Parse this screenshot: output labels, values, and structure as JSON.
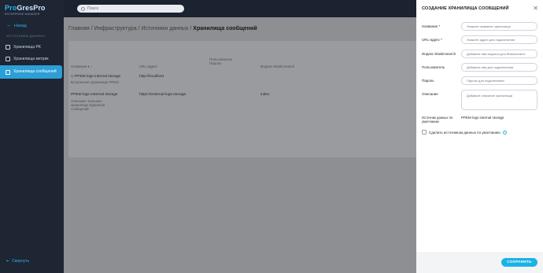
{
  "app": {
    "logo_line1_a": "Pro",
    "logo_line1_b": "GresPro",
    "logo_line2": "ENTERPRISE MANAGER"
  },
  "sidebar": {
    "back_label": "Назад",
    "section_title": "ИСТОЧНИКИ ДАННЫХ",
    "items": [
      {
        "label": "Хранилища PK"
      },
      {
        "label": "Хранилища метрик"
      },
      {
        "label": "Хранилища сообщений"
      }
    ],
    "collapse_label": "Свернуть"
  },
  "search": {
    "placeholder": "Поиск"
  },
  "breadcrumb": {
    "parts": [
      "Главная",
      "Инфраструктура",
      "Источники данных"
    ],
    "separator": " / ",
    "current": "Хранилища сообщений"
  },
  "table": {
    "headers": [
      "Название",
      "URL-адрес",
      "Пользователь Пароль",
      "Индекс Elasticsearch"
    ],
    "rows": [
      {
        "name": "PPEM logs internal storage",
        "sub": "Встроенное хранилище PPEM",
        "url": "http://localhost",
        "user": "",
        "index": ""
      },
      {
        "name": "PPEM logs external storage",
        "sub": "Описание: внешнее хранилище журналов сообщений",
        "url": "https://external-logs.storage",
        "user": "",
        "index": "index"
      }
    ]
  },
  "panel": {
    "title": "СОЗДАНИЕ ХРАНИЛИЩА СООБЩЕНИЙ",
    "fields": {
      "name_label": "Название *",
      "name_placeholder": "Укажите название хранилища",
      "url_label": "URL-адрес *",
      "url_placeholder": "Укажите адрес для подключения",
      "index_label": "Индекс Elasticsearch",
      "index_placeholder": "Добавьте имя индекса для Elasticsearch",
      "user_label": "Пользователь",
      "user_placeholder": "Добавьте имя для подключения",
      "password_label": "Пароль",
      "password_placeholder": "Пароль для подключения",
      "desc_label": "Описание",
      "desc_placeholder": "Добавьте описание хранилища"
    },
    "default_source_label": "Источник данных по умолчанию",
    "default_source_value": "PPEM logs internal storage",
    "make_default_label": "Сделать источником данных по умолчанию",
    "save_label": "СОХРАНИТЬ"
  },
  "colors": {
    "accent": "#1bb2e6",
    "sidebar_bg": "#1e2533",
    "overlay": "#8e8f93"
  }
}
